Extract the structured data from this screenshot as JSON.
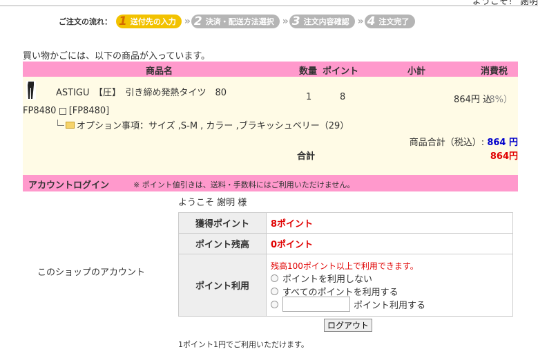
{
  "header": {
    "greeting": "ようこそ！ 謝明"
  },
  "flow": {
    "label": "ご注文の流れ：",
    "steps": [
      {
        "num": "1",
        "label": "送付先の入力"
      },
      {
        "num": "2",
        "label": "決済・配送方法選択"
      },
      {
        "num": "3",
        "label": "注文内容確認"
      },
      {
        "num": "4",
        "label": "注文完了"
      }
    ]
  },
  "cart": {
    "intro": "買い物かごには、以下の商品が入っています。",
    "columns": {
      "name": "商品名",
      "qty": "数量",
      "point": "ポイント",
      "subtotal": "小計",
      "tax": "消費税"
    },
    "item": {
      "name": "ASTIGU　【圧】　引き締め発熱タイツ　80",
      "code": "FP8480",
      "code_bracket": "[FP8480]",
      "option": "オプション事項：サイズ ,S-M , カラー ,ブラキッシュベリー（29）",
      "qty": "1",
      "point": "8",
      "subtotal": "864円 込",
      "tax_rate": "（8%）"
    },
    "goods_total_label": "商品合計（税込）:",
    "goods_total_value": "864 円",
    "total_label": "合計",
    "total_value": "864円"
  },
  "account": {
    "title": "アカウントログイン",
    "note": "※ ポイント値引きは、送料・手数料にはご利用いただけません。",
    "welcome": "ようこそ 謝明 様",
    "shop_account_label": "このショップのアカウント",
    "earned_label": "獲得ポイント",
    "earned_value": "8ポイント",
    "balance_label": "ポイント残高",
    "balance_value": "0ポイント",
    "use_label": "ポイント利用",
    "use_notice": "残高100ポイント以上で利用できます。",
    "options": [
      "ポイントを利用しない",
      "すべてのポイントを利用する",
      "ポイント利用する"
    ],
    "logout": "ログアウト",
    "footer": "1ポイント1円でご利用いただけます。"
  }
}
